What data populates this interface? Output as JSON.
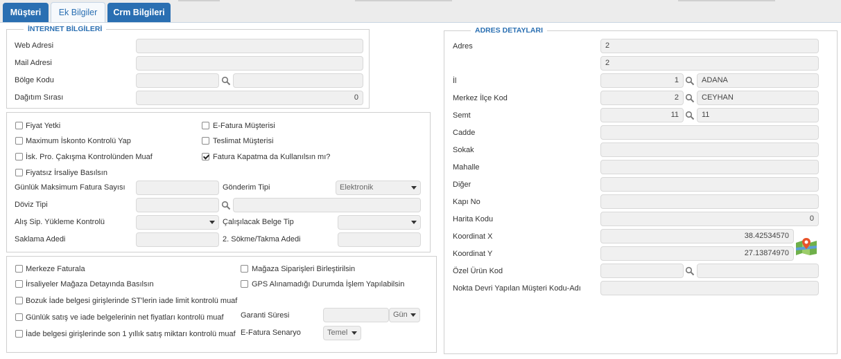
{
  "tabs": [
    {
      "label": "Müşteri"
    },
    {
      "label": "Ek Bilgiler"
    },
    {
      "label": "Crm Bilgileri"
    }
  ],
  "internet": {
    "legend": "İNTERNET BİLGİLERİ",
    "web_label": "Web Adresi",
    "web_value": "",
    "mail_label": "Mail Adresi",
    "mail_value": "",
    "region_label": "Bölge Kodu",
    "region_code": "",
    "region_name": "",
    "dist_label": "Dağıtım Sırası",
    "dist_value": "0"
  },
  "options": {
    "fiyat_yetki": "Fiyat Yetki",
    "max_iskonto": "Maximum İskonto Kontrolü Yap",
    "isk_pro": "İsk. Pro. Çakışma Kontrolünden Muaf",
    "fiyatsiz": "Fiyatsız İrsaliye Basılsın",
    "efatura_musteri": "E-Fatura Müşterisi",
    "teslimat": "Teslimat Müşterisi",
    "fatura_kapatma": "Fatura Kapatma da Kullanılsın mı?",
    "gunluk_max_label": "Günlük Maksimum Fatura Sayısı",
    "gunluk_max_value": "",
    "gonderim_label": "Gönderim Tipi",
    "gonderim_value": "Elektronik",
    "doviz_label": "Döviz Tipi",
    "doviz_code": "",
    "doviz_name": "",
    "alis_label": "Alış Sip. Yükleme Kontrolü",
    "alis_value": "",
    "calisilacak_label": "Çalışılacak Belge Tip",
    "calisilacak_value": "",
    "saklama_label": "Saklama Adedi",
    "saklama_value": "",
    "sokme_label": "2. Sökme/Takma Adedi",
    "sokme_value": ""
  },
  "store": {
    "merkeze": "Merkeze Faturala",
    "irsaliyeler": "İrsaliyeler Mağaza Detayında Basılsın",
    "bozuk": "Bozuk İade belgesi girişlerinde ST'lerin iade limit kontrolü muaf",
    "gunluk_satis": "Günlük satış ve iade belgelerinin net fiyatları kontrolü muaf",
    "iade_son": "İade belgesi girişlerinde son 1 yıllık satış miktarı kontrolü muaf",
    "magaza_sip": "Mağaza Siparişleri Birleştirilsin",
    "gps": "GPS Alınamadığı Durumda İşlem Yapılabilsin",
    "garanti_label": "Garanti Süresi",
    "garanti_value": "",
    "garanti_unit": "Gün",
    "efatura_senaryo_label": "E-Fatura Senaryo",
    "efatura_senaryo_value": "Temel"
  },
  "address": {
    "legend": "ADRES DETAYLARI",
    "adres_label": "Adres",
    "adres1": "2",
    "adres2": "2",
    "il_label": "İl",
    "il_code": "1",
    "il_name": "ADANA",
    "ilce_label": "Merkez İlçe Kod",
    "ilce_code": "2",
    "ilce_name": "CEYHAN",
    "semt_label": "Semt",
    "semt_code": "11",
    "semt_name": "11",
    "cadde_label": "Cadde",
    "cadde_value": "",
    "sokak_label": "Sokak",
    "sokak_value": "",
    "mahalle_label": "Mahalle",
    "mahalle_value": "",
    "diger_label": "Diğer",
    "diger_value": "",
    "kapi_label": "Kapı No",
    "kapi_value": "",
    "harita_label": "Harita Kodu",
    "harita_value": "0",
    "kx_label": "Koordinat X",
    "kx_value": "38.42534570",
    "ky_label": "Koordinat Y",
    "ky_value": "27.13874970",
    "ozel_label": "Özel Ürün Kod",
    "ozel_code": "",
    "ozel_name": "",
    "nokta_label": "Nokta Devri Yapılan Müşteri Kodu-Adı",
    "nokta_value": ""
  },
  "colors": {
    "accent": "#2a6fb2",
    "input_bg": "#f0f0f0",
    "border": "#cfcfcf"
  }
}
